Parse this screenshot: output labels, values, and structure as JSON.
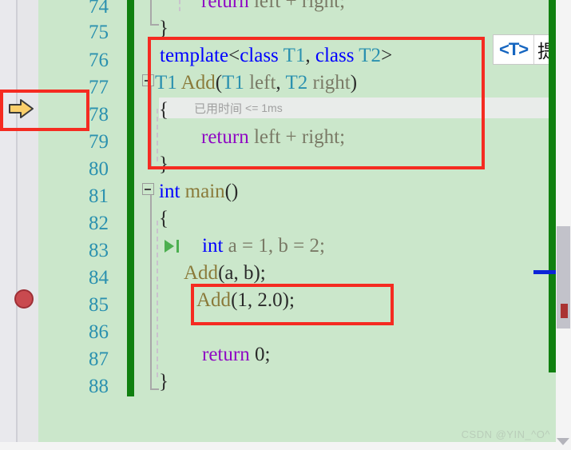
{
  "editor": {
    "language": "C++",
    "theme_background": "#cbe7cb",
    "gutter_background": "#e6e6e9",
    "linenumber_color": "#2b91af",
    "change_bar_color": "#108010",
    "annotation_color": "#f52b21"
  },
  "line_numbers": [
    "74",
    "75",
    "76",
    "77",
    "78",
    "79",
    "80",
    "81",
    "82",
    "83",
    "84",
    "85",
    "86",
    "87",
    "88"
  ],
  "code_lines": [
    {
      "line": "74",
      "text": "return left + right;",
      "clipped_top": true
    },
    {
      "line": "75",
      "text": "}"
    },
    {
      "line": "76",
      "text": "template<class T1, class T2>"
    },
    {
      "line": "77",
      "text": "T1 Add(T1 left, T2 right)"
    },
    {
      "line": "78",
      "text": "{"
    },
    {
      "line": "79",
      "text": "return left + right;"
    },
    {
      "line": "80",
      "text": "}"
    },
    {
      "line": "81",
      "text": "int main()"
    },
    {
      "line": "82",
      "text": "{"
    },
    {
      "line": "83",
      "text": "int a = 1, b = 2;"
    },
    {
      "line": "84",
      "text": "Add(a, b);"
    },
    {
      "line": "85",
      "text": "Add(1, 2.0);"
    },
    {
      "line": "86",
      "text": ""
    },
    {
      "line": "87",
      "text": "return 0;"
    },
    {
      "line": "88",
      "text": "}"
    }
  ],
  "tokens": {
    "l74_return": "return",
    "l74_rest": " left + right;",
    "l75_brace": "}",
    "l76_template": "template",
    "l76_lt": "<",
    "l76_class1": "class",
    "l76_t1": " T1",
    "l76_comma": ", ",
    "l76_class2": "class",
    "l76_t2": " T2",
    "l76_gt": ">",
    "l77_t1": "T1",
    "l77_add": " Add",
    "l77_open": "(",
    "l77_t1b": "T1",
    "l77_left": " left",
    "l77_comma": ", ",
    "l77_t2": "T2",
    "l77_right": " right",
    "l77_close": ")",
    "l78_brace": "{",
    "l79_return": "return",
    "l79_rest": " left + right;",
    "l80_brace": "}",
    "l81_int": "int",
    "l81_main": " main",
    "l81_parens": "()",
    "l82_brace": "{",
    "l83_int": "int",
    "l83_rest": " a = 1, b = 2;",
    "l84_add": "Add",
    "l84_args": "(a, b);",
    "l85_add": "Add",
    "l85_args": "(1, 2.0);",
    "l87_return": "return",
    "l87_rest": " 0;",
    "l88_brace": "}"
  },
  "adornments": {
    "elapsed_time_label": "已用时间",
    "elapsed_time_value": "<= 1ms",
    "instruction_pointer_line": "78",
    "breakpoint_line": "85",
    "run_to_cursor_line": "83"
  },
  "quick_action_chip": {
    "symbol": "<T>",
    "label": "提"
  },
  "annotations": [
    {
      "name": "ip-arrow-box",
      "target": "line 78 gutter arrow"
    },
    {
      "name": "template-function-box",
      "target": "lines 76-80 template Add"
    },
    {
      "name": "add-call-box",
      "target": "line 85 Add(1, 2.0);"
    }
  ],
  "watermark": {
    "text": "CSDN @YIN_^O^"
  }
}
